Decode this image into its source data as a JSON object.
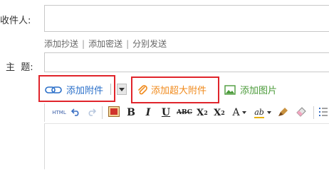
{
  "fields": {
    "to_label": "收件人:",
    "subject_label": "主  题:"
  },
  "recipient_links": {
    "cc": "添加抄送",
    "bcc": "添加密送",
    "separate": "分别发送",
    "separator": "|"
  },
  "attach_bar": {
    "add_attachment": "添加附件",
    "add_large_attachment": "添加超大附件",
    "add_image": "添加图片"
  },
  "toolbar": {
    "html": "HTML",
    "bold": "B",
    "italic": "I",
    "underline": "U",
    "strike": "ABC",
    "superscript_base": "X",
    "superscript_mark": "2",
    "subscript_base": "X",
    "subscript_mark": "2",
    "font_color": "A",
    "bg_color": "ab"
  },
  "colors": {
    "highlight_border": "#e0242b",
    "attach_blue": "#2a6fc9",
    "large_attach_orange": "#f08a1c",
    "image_green": "#4b9b3a"
  }
}
